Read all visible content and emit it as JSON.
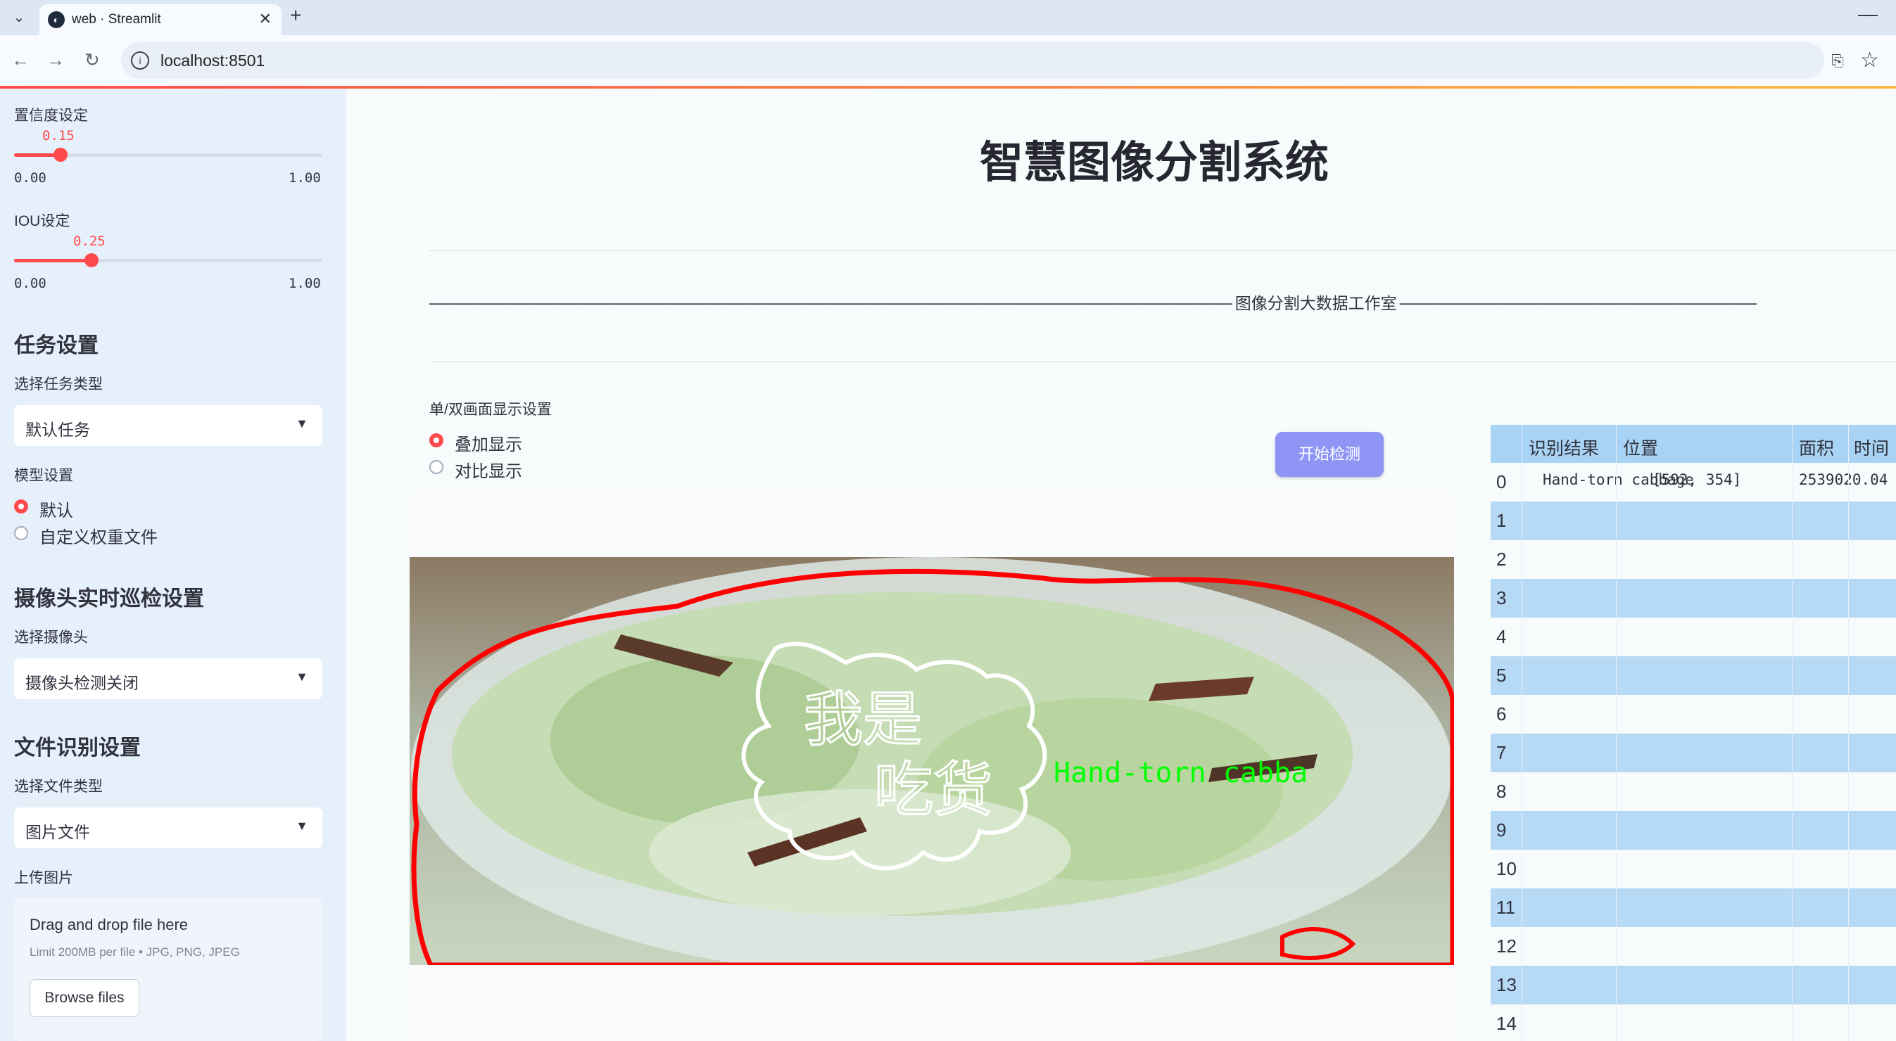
{
  "browser": {
    "tab_title": "web · Streamlit",
    "url": "localhost:8501"
  },
  "sidebar": {
    "confidence": {
      "label": "置信度设定",
      "value": "0.15",
      "value_fraction": 0.15,
      "min": "0.00",
      "max": "1.00"
    },
    "iou": {
      "label": "IOU设定",
      "value": "0.25",
      "value_fraction": 0.25,
      "min": "0.00",
      "max": "1.00"
    },
    "task_section": "任务设置",
    "task_type_label": "选择任务类型",
    "task_type_value": "默认任务",
    "model_label": "模型设置",
    "model_options": [
      "默认",
      "自定义权重文件"
    ],
    "model_selected": 0,
    "camera_section": "摄像头实时巡检设置",
    "camera_label": "选择摄像头",
    "camera_value": "摄像头检测关闭",
    "file_section": "文件识别设置",
    "file_type_label": "选择文件类型",
    "file_type_value": "图片文件",
    "upload_label": "上传图片",
    "upload": {
      "drop_text": "Drag and drop file here",
      "limit_text": "Limit 200MB per file • JPG, PNG, JPEG",
      "browse_label": "Browse files"
    }
  },
  "main": {
    "title": "智慧图像分割系统",
    "banner_text": "图像分割大数据工作室",
    "display_label": "单/双画面显示设置",
    "display_options": [
      "叠加显示",
      "对比显示"
    ],
    "display_selected": 0,
    "detect_button": "开始检测",
    "image": {
      "label_text": "Hand-torn cabba",
      "watermark_line1": "我是",
      "watermark_line2": "吃货",
      "mask_color": "#ff0000",
      "label_color": "#00ff00"
    }
  },
  "results_table": {
    "columns": [
      "识别结果",
      "位置",
      "面积",
      "时间"
    ],
    "rows": [
      {
        "index": "0",
        "result": "Hand-torn cabbage",
        "position": "[592, 354]",
        "area": "2539020.04",
        "time": ""
      },
      {
        "index": "1"
      },
      {
        "index": "2"
      },
      {
        "index": "3"
      },
      {
        "index": "4"
      },
      {
        "index": "5"
      },
      {
        "index": "6"
      },
      {
        "index": "7"
      },
      {
        "index": "8"
      },
      {
        "index": "9"
      },
      {
        "index": "10"
      },
      {
        "index": "11"
      },
      {
        "index": "12"
      },
      {
        "index": "13"
      },
      {
        "index": "14"
      }
    ]
  },
  "colors": {
    "accent": "#ff4b4b",
    "sidebar_bg": "#e6f0fb",
    "button_bg": "#8e95f5",
    "table_header_bg": "#a9d3f4"
  }
}
